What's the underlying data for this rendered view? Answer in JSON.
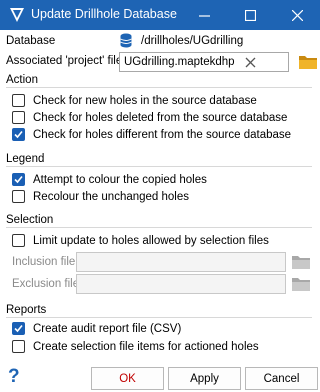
{
  "window": {
    "title": "Update Drillhole Database",
    "minimize_glyph": "—",
    "maximize_glyph": "☐",
    "close_glyph": "✕"
  },
  "database": {
    "label": "Database",
    "value": "/drillholes/UGdrilling",
    "icon": "database-icon"
  },
  "project": {
    "label": "Associated 'project' file",
    "value": "UGdrilling.maptekdhp",
    "clear_glyph": "✕",
    "icon": "folder-icon"
  },
  "action": {
    "title": "Action",
    "options": [
      {
        "label": "Check for new holes in the source database",
        "checked": false
      },
      {
        "label": "Check for holes deleted from the source database",
        "checked": false
      },
      {
        "label": "Check for holes different from the source database",
        "checked": true
      }
    ]
  },
  "legend": {
    "title": "Legend",
    "options": [
      {
        "label": "Attempt to colour the copied holes",
        "checked": true
      },
      {
        "label": "Recolour the unchanged holes",
        "checked": false
      }
    ]
  },
  "selection": {
    "title": "Selection",
    "limit_label": "Limit update to holes allowed by selection files",
    "limit_checked": false,
    "inclusion_label": "Inclusion file",
    "exclusion_label": "Exclusion file",
    "inclusion_value": "",
    "exclusion_value": ""
  },
  "reports": {
    "title": "Reports",
    "options": [
      {
        "label": "Create audit report file (CSV)",
        "checked": true
      },
      {
        "label": "Create selection file items for actioned holes",
        "checked": false
      }
    ]
  },
  "footer": {
    "help_glyph": "?",
    "ok_label": "OK",
    "apply_label": "Apply",
    "cancel_label": "Cancel"
  },
  "colors": {
    "titlebar": "#1e64b4",
    "checkbox_checked": "#1a5fb4",
    "ok_text": "#c00000",
    "folder": "#e8a317"
  }
}
